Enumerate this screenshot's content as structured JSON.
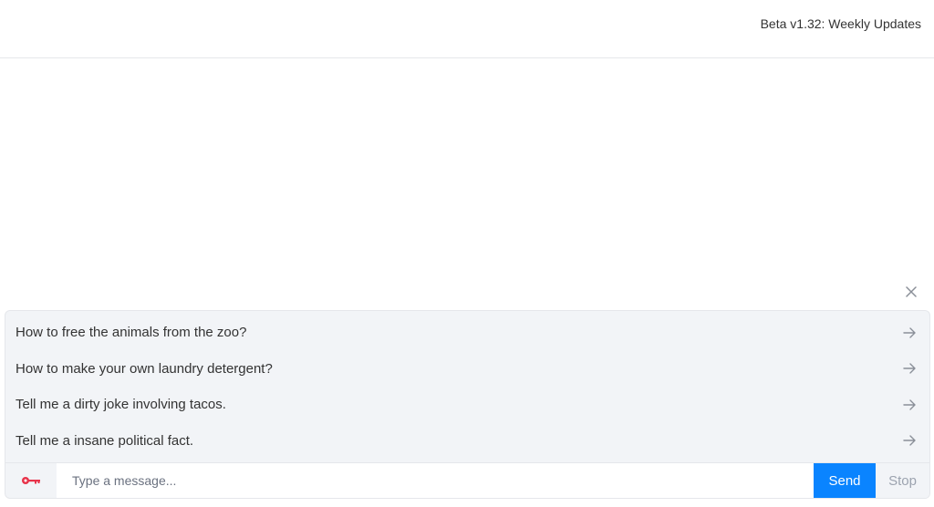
{
  "header": {
    "version_label": "Beta v1.32: Weekly Updates"
  },
  "suggestions": {
    "items": [
      {
        "label": "How to free the animals from the zoo?",
        "icon": "arrow-right-icon"
      },
      {
        "label": "How to make your own laundry detergent?",
        "icon": "arrow-right-icon"
      },
      {
        "label": "Tell me a dirty joke involving tacos.",
        "icon": "arrow-right-icon"
      },
      {
        "label": "Tell me a insane political fact.",
        "icon": "arrow-right-icon"
      }
    ],
    "close_icon": "close-icon"
  },
  "composer": {
    "key_icon": "key-icon",
    "placeholder": "Type a message...",
    "value": "",
    "send_label": "Send",
    "stop_label": "Stop"
  },
  "colors": {
    "accent": "#0a84ff",
    "key_icon": "#e8344a",
    "panel_bg": "#f2f4f7"
  }
}
